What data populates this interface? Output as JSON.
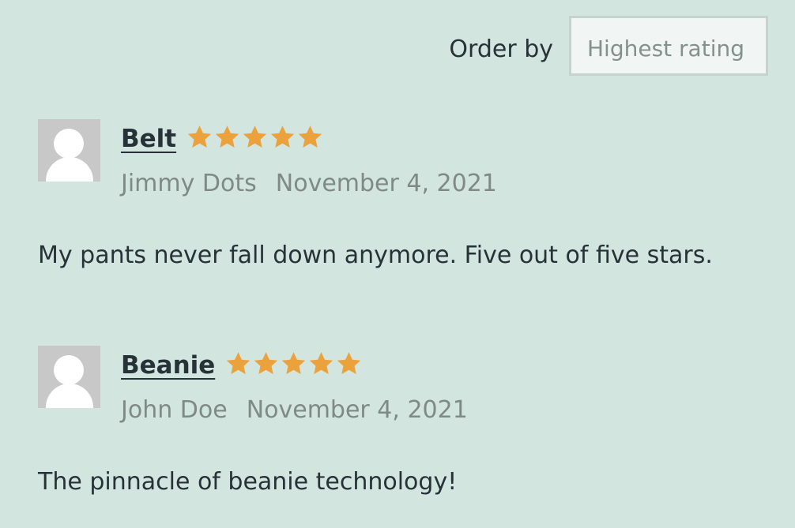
{
  "order": {
    "label": "Order by",
    "selected": "Highest rating"
  },
  "reviews": [
    {
      "product": "Belt",
      "rating": 5,
      "rating_max": 5,
      "author": "Jimmy Dots",
      "date": "November 4, 2021",
      "text": "My pants never fall down anymore. Five out of five stars."
    },
    {
      "product": "Beanie",
      "rating": 5,
      "rating_max": 5,
      "author": "John Doe",
      "date": "November 4, 2021",
      "text": "The pinnacle of beanie technology!"
    }
  ],
  "colors": {
    "background": "#d2e5df",
    "star": "#eba23d",
    "text": "#263238",
    "muted": "#7f8a87"
  }
}
